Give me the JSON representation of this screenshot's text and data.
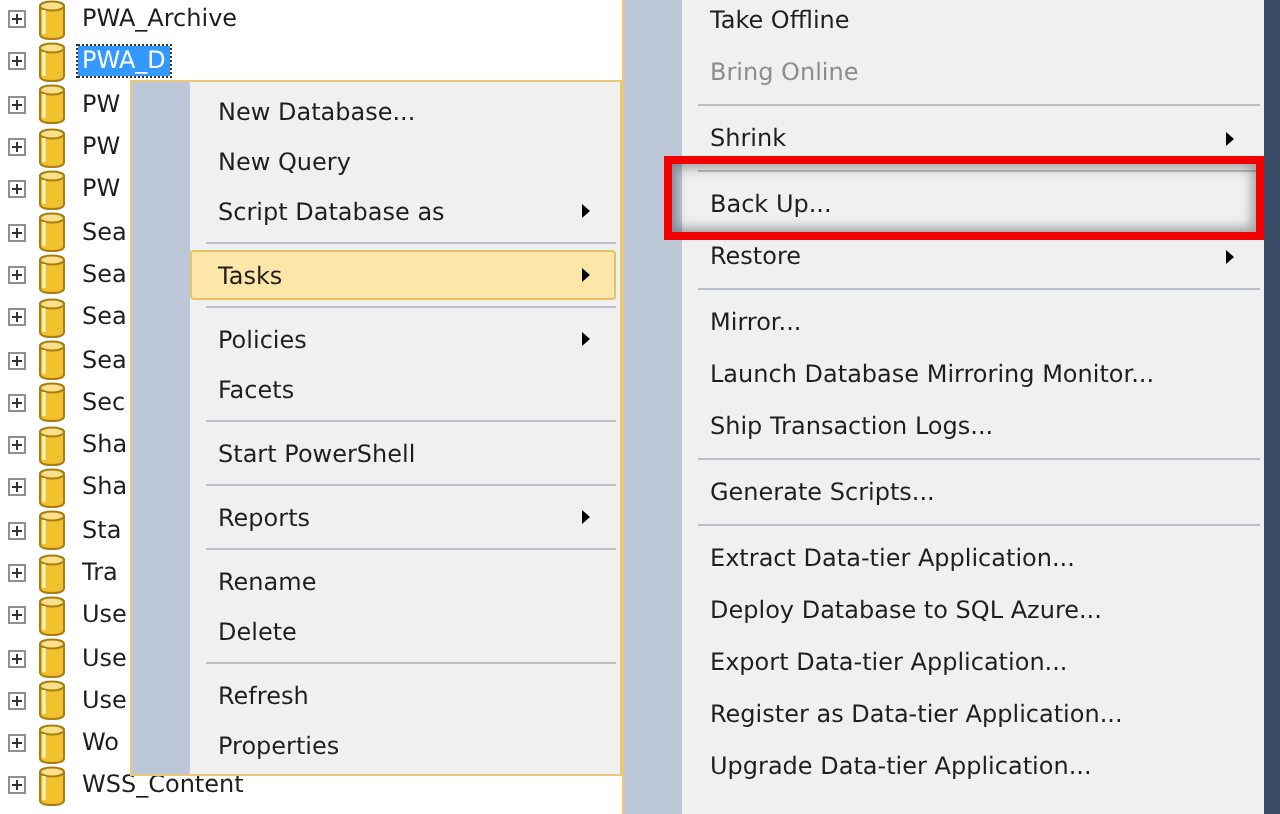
{
  "tree": {
    "items": [
      {
        "label": "PWA_Archive",
        "selected": false
      },
      {
        "label": "PWA_D",
        "selected": true
      },
      {
        "label": "PW",
        "selected": false
      },
      {
        "label": "PW",
        "selected": false
      },
      {
        "label": "PW",
        "selected": false
      },
      {
        "label": "Sea",
        "selected": false
      },
      {
        "label": "Sea",
        "selected": false
      },
      {
        "label": "Sea",
        "selected": false
      },
      {
        "label": "Sea",
        "selected": false
      },
      {
        "label": "Sec",
        "selected": false
      },
      {
        "label": "Sha",
        "selected": false
      },
      {
        "label": "Sha",
        "selected": false
      },
      {
        "label": "Sta",
        "selected": false
      },
      {
        "label": "Tra",
        "selected": false
      },
      {
        "label": "Use",
        "selected": false
      },
      {
        "label": "Use",
        "selected": false
      },
      {
        "label": "Use",
        "selected": false
      },
      {
        "label": "Wo",
        "selected": false
      },
      {
        "label": "WSS_Content",
        "selected": false
      }
    ]
  },
  "context_menu": {
    "items": [
      {
        "kind": "item",
        "label": "New Database...",
        "submenu": false,
        "selected": false
      },
      {
        "kind": "item",
        "label": "New Query",
        "submenu": false,
        "selected": false
      },
      {
        "kind": "item",
        "label": "Script Database as",
        "submenu": true,
        "selected": false
      },
      {
        "kind": "separator"
      },
      {
        "kind": "item",
        "label": "Tasks",
        "submenu": true,
        "selected": true
      },
      {
        "kind": "separator"
      },
      {
        "kind": "item",
        "label": "Policies",
        "submenu": true,
        "selected": false
      },
      {
        "kind": "item",
        "label": "Facets",
        "submenu": false,
        "selected": false
      },
      {
        "kind": "separator"
      },
      {
        "kind": "item",
        "label": "Start PowerShell",
        "submenu": false,
        "selected": false
      },
      {
        "kind": "separator"
      },
      {
        "kind": "item",
        "label": "Reports",
        "submenu": true,
        "selected": false
      },
      {
        "kind": "separator"
      },
      {
        "kind": "item",
        "label": "Rename",
        "submenu": false,
        "selected": false
      },
      {
        "kind": "item",
        "label": "Delete",
        "submenu": false,
        "selected": false
      },
      {
        "kind": "separator"
      },
      {
        "kind": "item",
        "label": "Refresh",
        "submenu": false,
        "selected": false
      },
      {
        "kind": "item",
        "label": "Properties",
        "submenu": false,
        "selected": false
      }
    ]
  },
  "tasks_submenu": {
    "items": [
      {
        "kind": "item",
        "label": "Take Offline",
        "submenu": false,
        "disabled": false,
        "highlighted": false
      },
      {
        "kind": "item",
        "label": "Bring Online",
        "submenu": false,
        "disabled": true,
        "highlighted": false
      },
      {
        "kind": "separator"
      },
      {
        "kind": "item",
        "label": "Shrink",
        "submenu": true,
        "disabled": false,
        "highlighted": false
      },
      {
        "kind": "separator"
      },
      {
        "kind": "item",
        "label": "Back Up...",
        "submenu": false,
        "disabled": false,
        "highlighted": true
      },
      {
        "kind": "item",
        "label": "Restore",
        "submenu": true,
        "disabled": false,
        "highlighted": false
      },
      {
        "kind": "separator"
      },
      {
        "kind": "item",
        "label": "Mirror...",
        "submenu": false,
        "disabled": false,
        "highlighted": false
      },
      {
        "kind": "item",
        "label": "Launch Database Mirroring Monitor...",
        "submenu": false,
        "disabled": false,
        "highlighted": false
      },
      {
        "kind": "item",
        "label": "Ship Transaction Logs...",
        "submenu": false,
        "disabled": false,
        "highlighted": false
      },
      {
        "kind": "separator"
      },
      {
        "kind": "item",
        "label": "Generate Scripts...",
        "submenu": false,
        "disabled": false,
        "highlighted": false
      },
      {
        "kind": "separator"
      },
      {
        "kind": "item",
        "label": "Extract Data-tier Application...",
        "submenu": false,
        "disabled": false,
        "highlighted": false
      },
      {
        "kind": "item",
        "label": "Deploy Database to SQL Azure...",
        "submenu": false,
        "disabled": false,
        "highlighted": false
      },
      {
        "kind": "item",
        "label": "Export Data-tier Application...",
        "submenu": false,
        "disabled": false,
        "highlighted": false
      },
      {
        "kind": "item",
        "label": "Register as Data-tier Application...",
        "submenu": false,
        "disabled": false,
        "highlighted": false
      },
      {
        "kind": "item",
        "label": "Upgrade Data-tier Application...",
        "submenu": false,
        "disabled": false,
        "highlighted": false
      }
    ]
  }
}
